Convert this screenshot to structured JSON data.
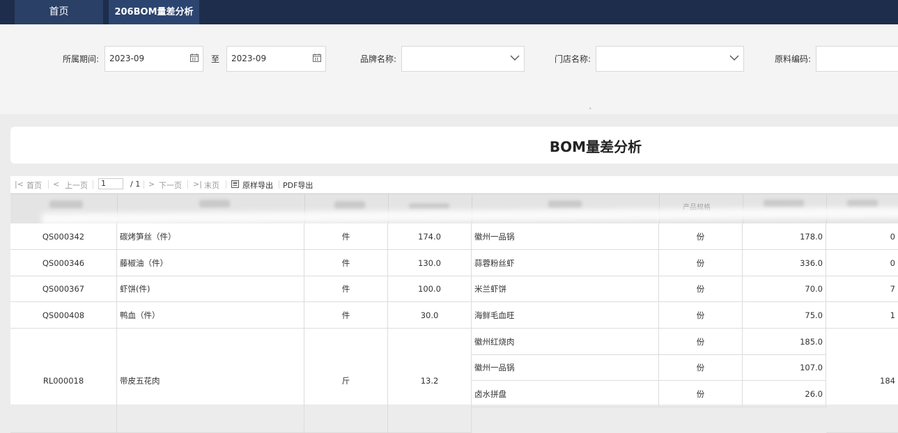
{
  "tabs": {
    "home": "首页",
    "active": "206BOM量差分析"
  },
  "filters": {
    "period_label": "所属期间:",
    "start": "2023-09",
    "to": "至",
    "end": "2023-09",
    "brand_label": "品牌名称:",
    "store_label": "门店名称:",
    "material_label": "原料编码:"
  },
  "report": {
    "title": "BOM量差分析"
  },
  "pager": {
    "first": "首页",
    "prev": "上一页",
    "page": "1",
    "total": "/ 1",
    "next": "下一页",
    "last": "末页",
    "export_original": "原样导出",
    "export_pdf": "PDF导出"
  },
  "table": {
    "header_partial": "产品规格",
    "rows": [
      {
        "code": "QS000342",
        "name": "碳烤笋丝（件）",
        "unit": "件",
        "qty": "174.0",
        "product": "徽州一品锅",
        "punit": "份",
        "pqty": "178.0",
        "last": "0"
      },
      {
        "code": "QS000346",
        "name": "藤椒油（件）",
        "unit": "件",
        "qty": "130.0",
        "product": "蒜蓉粉丝虾",
        "punit": "份",
        "pqty": "336.0",
        "last": "0"
      },
      {
        "code": "QS000367",
        "name": "虾饼(件)",
        "unit": "件",
        "qty": "100.0",
        "product": "米兰虾饼",
        "punit": "份",
        "pqty": "70.0",
        "last": "7"
      },
      {
        "code": "QS000408",
        "name": "鸭血（件）",
        "unit": "件",
        "qty": "30.0",
        "product": "海鲜毛血旺",
        "punit": "份",
        "pqty": "75.0",
        "last": "1"
      }
    ],
    "group": {
      "code": "RL000018",
      "name": "带皮五花肉",
      "unit": "斤",
      "qty": "13.2",
      "last": "184",
      "items": [
        {
          "product": "徽州红烧肉",
          "punit": "份",
          "pqty": "185.0"
        },
        {
          "product": "徽州一品锅",
          "punit": "份",
          "pqty": "107.0"
        },
        {
          "product": "卤水拼盘",
          "punit": "份",
          "pqty": "26.0"
        }
      ]
    }
  }
}
